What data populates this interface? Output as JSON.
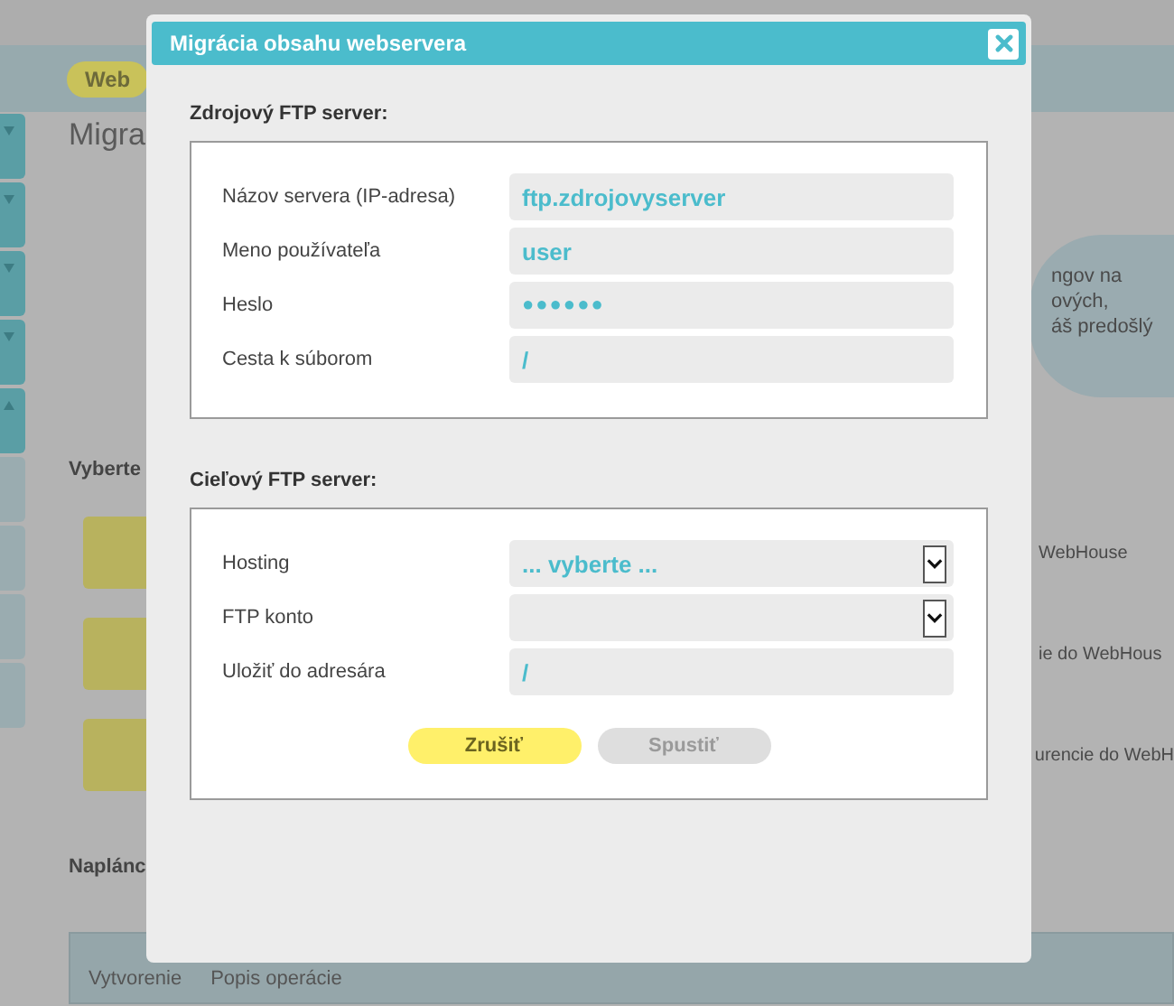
{
  "background": {
    "nav_tab": "Web",
    "heading": "Migra",
    "sidebar_tabs": [
      {
        "kind": "down",
        "dimmed": false
      },
      {
        "kind": "down",
        "dimmed": false
      },
      {
        "kind": "down",
        "dimmed": false
      },
      {
        "kind": "down",
        "dimmed": false
      },
      {
        "kind": "up",
        "dimmed": false
      },
      {
        "kind": "plain",
        "dimmed": true
      },
      {
        "kind": "plain",
        "dimmed": true
      },
      {
        "kind": "plain",
        "dimmed": true
      },
      {
        "kind": "plain",
        "dimmed": true
      }
    ],
    "info_lines": [
      "ngov na",
      "ových,",
      "áš predošlý"
    ],
    "section_label": "Vyberte",
    "options": [
      "WebHouse",
      "ie do WebHous",
      "urencie do WebH"
    ],
    "scheduled_label": "Naplánc",
    "table": {
      "columns": [
        "Vytvorenie",
        "Popis operácie"
      ]
    }
  },
  "dialog": {
    "title": "Migrácia obsahu webservera",
    "sections": [
      {
        "title": "Zdrojový FTP server:",
        "fields": [
          {
            "kind": "text",
            "label": "Názov servera (IP-adresa)",
            "value": "ftp.zdrojovyserver"
          },
          {
            "kind": "text",
            "label": "Meno používateľa",
            "value": "user"
          },
          {
            "kind": "password",
            "label": "Heslo",
            "value": "●●●●●●"
          },
          {
            "kind": "text",
            "label": "Cesta k súborom",
            "value": "/"
          }
        ]
      },
      {
        "title": "Cieľový FTP server:",
        "fields": [
          {
            "kind": "select",
            "label": "Hosting",
            "value": "... vyberte ..."
          },
          {
            "kind": "select",
            "label": "FTP konto"
          },
          {
            "kind": "text",
            "label": "Uložiť do adresára",
            "value": "/"
          }
        ],
        "buttons": [
          {
            "label": "Zrušiť",
            "disabled": false
          },
          {
            "label": "Spustiť",
            "disabled": true
          }
        ]
      }
    ]
  }
}
